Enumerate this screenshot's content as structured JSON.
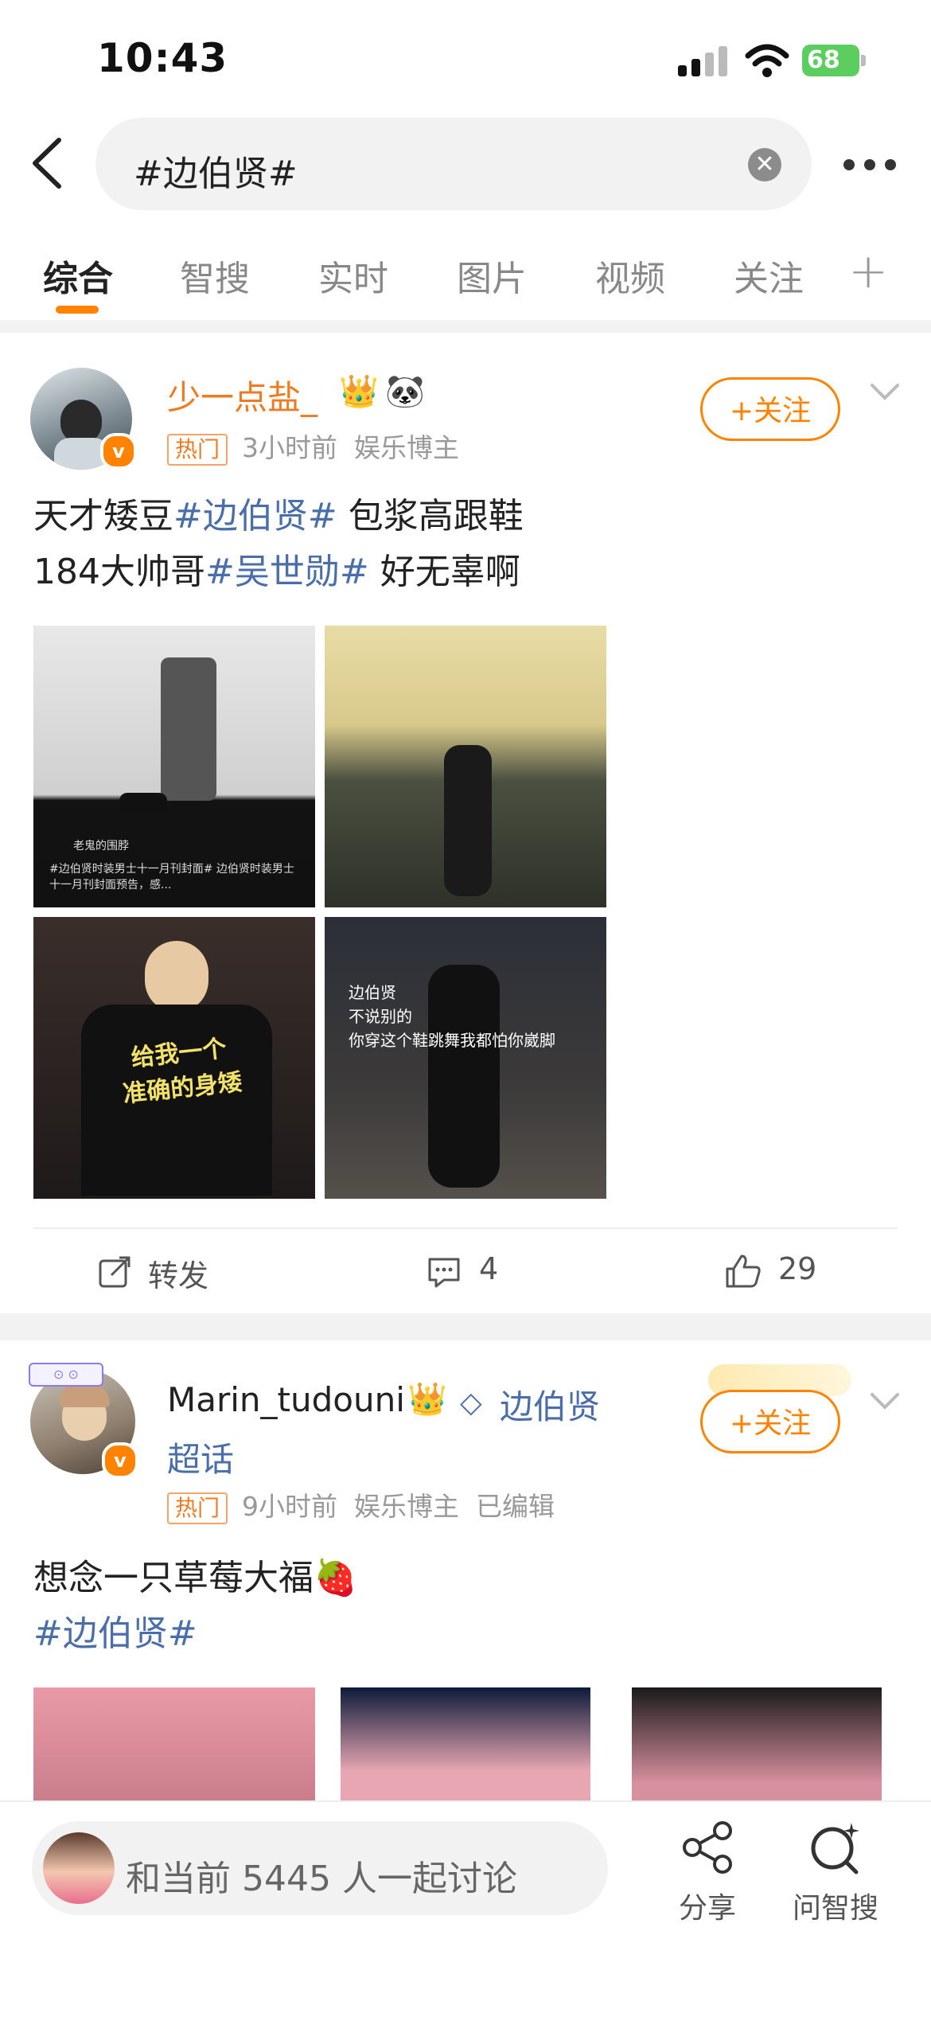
{
  "status_bar": {
    "time": "10:43",
    "battery": "68"
  },
  "search": {
    "query": "#边伯贤#"
  },
  "tabs": [
    "综合",
    "智搜",
    "实时",
    "图片",
    "视频",
    "关注"
  ],
  "posts": [
    {
      "user": "少一点盐_",
      "hot": "热门",
      "time": "3小时前",
      "role": "娱乐博主",
      "follow": "+关注",
      "line1_a": "天才矮豆",
      "line1_tag": "#边伯贤#",
      "line1_b": " 包浆高跟鞋",
      "line2_a": "184大帅哥",
      "line2_tag": "#吴世勋#",
      "line2_b": " 好无辜啊",
      "image_texts": {
        "img1_caption": "#边伯贤时装男士十一月刊封面# 边伯贤时装男士十一月刊封面预告，感...",
        "img1_user": "老鬼的围脖",
        "img3_text": "给我一个\n准确的身矮",
        "img4_text": "边伯贤\n不说别的\n你穿这个鞋跳舞我都怕你崴脚"
      },
      "repost": "转发",
      "comments": "4",
      "likes": "29"
    },
    {
      "user": "Marin_tudouni",
      "supertopic": "边伯贤",
      "supertopic_suffix": "超话",
      "hot": "热门",
      "time": "9小时前",
      "role": "娱乐博主",
      "edited": "已编辑",
      "follow": "+关注",
      "text_a": "想念一只草莓大福🍓",
      "text_tag": "#边伯贤#"
    }
  ],
  "bottom": {
    "discuss": "和当前 5445 人一起讨论",
    "share": "分享",
    "ask": "问智搜"
  }
}
